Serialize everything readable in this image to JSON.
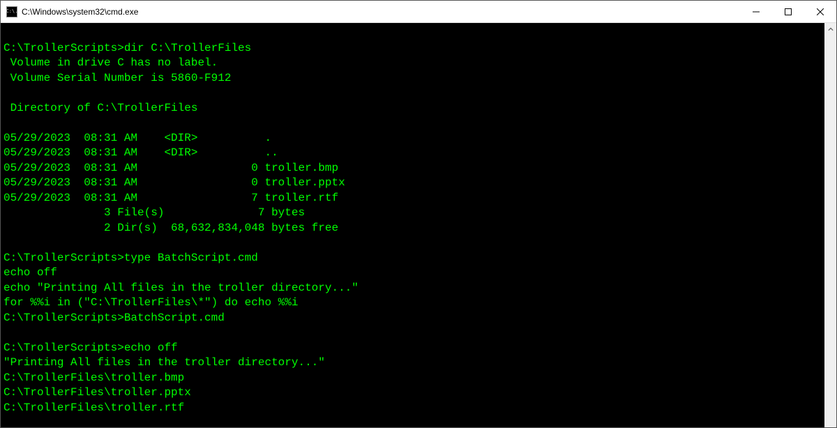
{
  "window": {
    "title": "C:\\Windows\\system32\\cmd.exe",
    "icon_label": "C:\\."
  },
  "terminal": {
    "lines": [
      "",
      "C:\\TrollerScripts>dir C:\\TrollerFiles",
      " Volume in drive C has no label.",
      " Volume Serial Number is 5860-F912",
      "",
      " Directory of C:\\TrollerFiles",
      "",
      "05/29/2023  08:31 AM    <DIR>          .",
      "05/29/2023  08:31 AM    <DIR>          ..",
      "05/29/2023  08:31 AM                 0 troller.bmp",
      "05/29/2023  08:31 AM                 0 troller.pptx",
      "05/29/2023  08:31 AM                 7 troller.rtf",
      "               3 File(s)              7 bytes",
      "               2 Dir(s)  68,632,834,048 bytes free",
      "",
      "C:\\TrollerScripts>type BatchScript.cmd",
      "echo off",
      "echo \"Printing All files in the troller directory...\"",
      "for %%i in (\"C:\\TrollerFiles\\*\") do echo %%i",
      "C:\\TrollerScripts>BatchScript.cmd",
      "",
      "C:\\TrollerScripts>echo off",
      "\"Printing All files in the troller directory...\"",
      "C:\\TrollerFiles\\troller.bmp",
      "C:\\TrollerFiles\\troller.pptx",
      "C:\\TrollerFiles\\troller.rtf"
    ]
  }
}
